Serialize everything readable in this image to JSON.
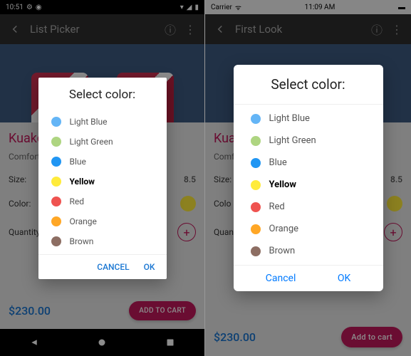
{
  "android": {
    "statusbar": {
      "time": "10:51"
    },
    "appbar": {
      "title": "List Picker"
    },
    "product": {
      "name": "Kuako",
      "desc": "Comfort",
      "size_label": "Size:",
      "size_value": "8.5",
      "color_label": "Color:",
      "qty_label": "Quantity:",
      "price": "$230.00",
      "cart": "ADD TO CART"
    },
    "dialog": {
      "title": "Select color:",
      "cancel": "CANCEL",
      "ok": "OK"
    }
  },
  "ios": {
    "statusbar": {
      "carrier": "Carrier",
      "time": "11:09 AM"
    },
    "appbar": {
      "title": "First Look"
    },
    "product": {
      "name": "Kual",
      "desc": "Comf",
      "size_label": "Size:",
      "size_value": "8.5",
      "color_label": "Colo",
      "qty_label": "Quan",
      "price": "$230.00",
      "cart": "Add to cart"
    },
    "dialog": {
      "title": "Select color:",
      "cancel": "Cancel",
      "ok": "OK"
    }
  },
  "colors": [
    {
      "label": "Light Blue",
      "hex": "#64b5f6",
      "selected": false
    },
    {
      "label": "Light Green",
      "hex": "#aed581",
      "selected": false
    },
    {
      "label": "Blue",
      "hex": "#2196f3",
      "selected": false
    },
    {
      "label": "Yellow",
      "hex": "#ffeb3b",
      "selected": true
    },
    {
      "label": "Red",
      "hex": "#ef5350",
      "selected": false
    },
    {
      "label": "Orange",
      "hex": "#ffa726",
      "selected": false
    },
    {
      "label": "Brown",
      "hex": "#8d6e63",
      "selected": false
    }
  ]
}
